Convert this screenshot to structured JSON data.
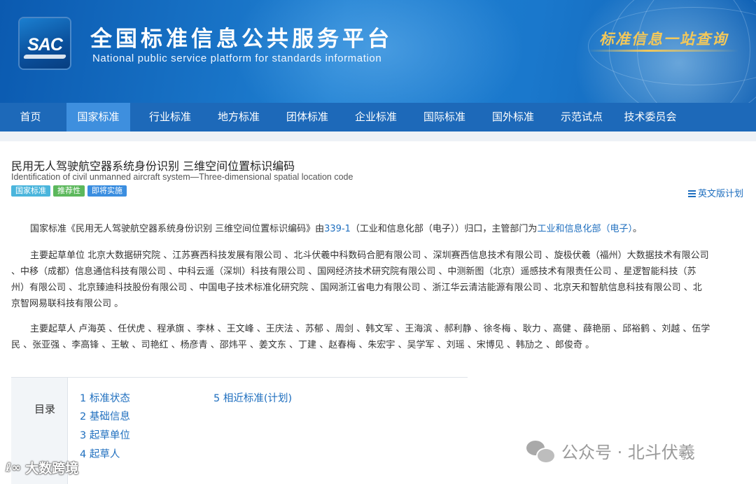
{
  "header": {
    "logo_text": "SAC",
    "title": "全国标准信息公共服务平台",
    "subtitle": "National public service platform  for standards information",
    "slogan": "标准信息一站查询"
  },
  "nav": {
    "items": [
      {
        "label": "首页",
        "active": false
      },
      {
        "label": "国家标准",
        "active": true
      },
      {
        "label": "行业标准",
        "active": false
      },
      {
        "label": "地方标准",
        "active": false
      },
      {
        "label": "团体标准",
        "active": false
      },
      {
        "label": "企业标准",
        "active": false
      },
      {
        "label": "国际标准",
        "active": false
      },
      {
        "label": "国外标准",
        "active": false
      },
      {
        "label": "示范试点",
        "active": false
      },
      {
        "label": "技术委员会",
        "active": false
      }
    ]
  },
  "standard": {
    "title": "民用无人驾驶航空器系统身份识别 三维空间位置标识编码",
    "title_en": "Identification of civil unmanned aircraft system—Three-dimensional spatial location code",
    "badges": [
      {
        "label": "国家标准",
        "color": "#4ab5dc"
      },
      {
        "label": "推荐性",
        "color": "#5cb85c"
      },
      {
        "label": "即将实施",
        "color": "#3b8ee0"
      }
    ],
    "en_plan_label": "英文版计划",
    "en_plan_icon": "list-icon"
  },
  "intro": {
    "prefix": "国家标准《民用无人驾驶航空器系统身份识别 三维空间位置标识编码》由",
    "tc_code": "339-1",
    "middle": "（工业和信息化部（电子））归口，主管部门为",
    "authority": "工业和信息化部（电子）",
    "suffix": "。"
  },
  "drafting_units": {
    "line1": "主要起草单位 北京大数据研究院 、江苏赛西科技发展有限公司 、北斗伏羲中科数码合肥有限公司 、深圳赛西信息技术有限公司 、旋极伏羲（福州）大数据技术有限公司",
    "line2": "、中移（成都）信息通信科技有限公司 、中科云遥（深圳）科技有限公司 、国网经济技术研究院有限公司 、中测新图（北京）遥感技术有限责任公司 、星逻智能科技（苏",
    "line3": "州）有限公司 、北京臻迪科技股份有限公司 、中国电子技术标准化研究院 、国网浙江省电力有限公司 、浙江华云清洁能源有限公司 、北京天和智航信息科技有限公司 、北",
    "line4": "京智网易联科技有限公司 。"
  },
  "drafters": {
    "line1": "主要起草人 卢海英 、任伏虎 、程承旗 、李林 、王文峰 、王庆法 、苏郁 、周剑 、韩文军 、王海滨 、郝利静 、徐冬梅 、耿力 、高健 、薛艳丽 、邱裕鹤 、刘越 、伍学",
    "line2": "民 、张亚强 、李高锋 、王敏 、司艳红 、杨彦青 、邵炜平 、姜文东 、丁建 、赵春梅 、朱宏宇 、吴学军 、刘瑶 、宋博见 、韩劢之 、郎俊奇 。"
  },
  "toc": {
    "label": "目录",
    "items": [
      {
        "label": "1  标准状态"
      },
      {
        "label": "2  基础信息"
      },
      {
        "label": "3  起草单位"
      },
      {
        "label": "4  起草人"
      },
      {
        "label": "5  相近标准(计划)"
      }
    ]
  },
  "watermarks": {
    "wechat_text": "公众号 · 北斗伏羲",
    "wechat_icon": "wechat-icon",
    "left_text": "大数跨境",
    "left_icon": "ℓ∞"
  }
}
